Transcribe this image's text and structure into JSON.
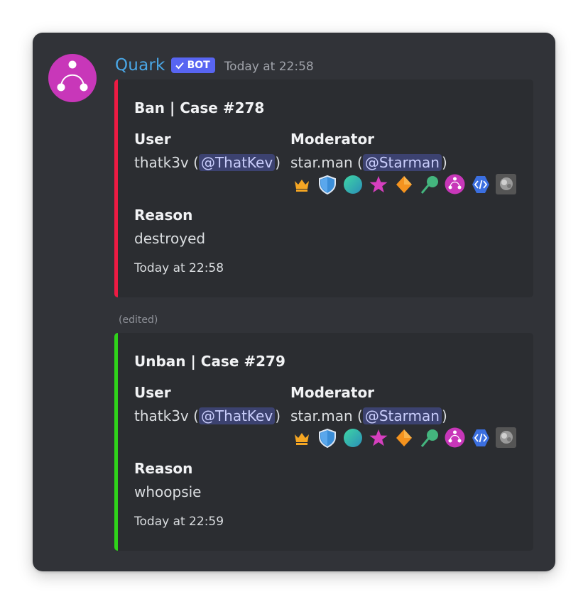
{
  "message": {
    "author": "Quark",
    "bot_tag": "BOT",
    "timestamp": "Today at 22:58",
    "edited_label": "(edited)"
  },
  "embeds": [
    {
      "title": "Ban | Case #278",
      "color": "#ed1b43",
      "user_label": "User",
      "user_name": "thatk3v",
      "user_mention": "@ThatKev",
      "moderator_label": "Moderator",
      "moderator_name": "star.man",
      "moderator_mention": "@Starman",
      "reason_label": "Reason",
      "reason": "destroyed",
      "footer": "Today at 22:58"
    },
    {
      "title": "Unban | Case #279",
      "color": "#2fd31a",
      "user_label": "User",
      "user_name": "thatk3v",
      "user_mention": "@ThatKev",
      "moderator_label": "Moderator",
      "moderator_name": "star.man",
      "moderator_mention": "@Starman",
      "reason_label": "Reason",
      "reason": "whoopsie",
      "footer": "Today at 22:59"
    }
  ],
  "badges": [
    "crown-badge-icon",
    "shield-badge-icon",
    "globe-badge-icon",
    "star-badge-icon",
    "diamond-badge-icon",
    "leaf-badge-icon",
    "quark-badge-icon",
    "dev-badge-icon",
    "photo-badge-icon"
  ],
  "colors": {
    "background": "#313338",
    "embed_bg": "#2b2d31",
    "username": "#4aa7e6",
    "bot_tag": "#5865f2",
    "mention_bg": "#3c4270"
  }
}
